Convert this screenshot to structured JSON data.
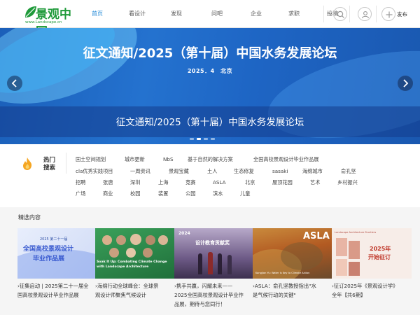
{
  "logo": {
    "text": "景观中国",
    "url": "www.Landscape.cn"
  },
  "nav": [
    {
      "label": "首页",
      "active": true
    },
    {
      "label": "看设计",
      "active": false
    },
    {
      "label": "发现",
      "active": false
    },
    {
      "label": "问吧",
      "active": false
    },
    {
      "label": "企业",
      "active": false
    },
    {
      "label": "求职",
      "active": false
    },
    {
      "label": "投稿",
      "active": false
    }
  ],
  "header_actions": {
    "publish_label": "发布",
    "icons": [
      "search-icon",
      "user-icon",
      "plus-icon"
    ]
  },
  "banner": {
    "title": "征文通知/2025（第十届）中国水务发展论坛",
    "subtitle": "2025．4　北京",
    "caption": "征文通知/2025（第十届）中国水务发展论坛",
    "slides": 4,
    "active_slide": 1
  },
  "hot_search": {
    "label_line1": "热门",
    "label_line2": "搜索",
    "rows": [
      [
        "国土空间规划",
        "城市更新",
        "NbS",
        "基于自然的解决方案",
        "全国高校景观设计毕业作品展"
      ],
      [
        "cla优秀实践项目",
        "一周资讯",
        "景观宝藏",
        "土人",
        "生态修复",
        "sasaki",
        "海绵城市",
        "俞孔坚"
      ],
      [
        "招聘",
        "张唐",
        "深圳",
        "上海",
        "竞赛",
        "ASLA",
        "北京",
        "屋顶花园",
        "艺术",
        "乡村振兴"
      ],
      [
        "广场",
        "商业",
        "校园",
        "装置",
        "公园",
        "滨水",
        "儿童"
      ]
    ]
  },
  "featured": {
    "title": "精选内容",
    "cards": [
      {
        "caption_line1": "征集启动 | 2025第二十一届全",
        "caption_line2": "国高校景观设计毕业作品展",
        "caption_line3": "",
        "image": "graduation-exhibition-poster",
        "poster_line1": "2025 第二十一届",
        "poster_line2": "全国高校景观设计",
        "poster_line3": "毕业作品展"
      },
      {
        "caption_line1": "海绵行动全球峰会：全球景",
        "caption_line2": "观设计师聚焦气候设计",
        "caption_line3": "",
        "image": "climate-summit-speakers",
        "poster_line1": "Soak It Up: Combating Climate Change",
        "poster_line2": "with Landscape Architecture",
        "poster_line3": ""
      },
      {
        "caption_line1": "携手共赢，闪耀未来——",
        "caption_line2": "2025全国高校景观设计毕业作",
        "caption_line3": "品展，期待与您同行！",
        "image": "exhibition-stage-photo",
        "poster_line1": "2024",
        "poster_line2": "设计教育贡献奖",
        "poster_line3": ""
      },
      {
        "caption_line1": "ASLA：俞孔坚教授指出\"水",
        "caption_line2": "是气候行动的关键\"",
        "caption_line3": "",
        "image": "asla-aerial-photo",
        "poster_line1": "ASLA",
        "poster_line2": "Kongjian Yu: Water Is Key to Climate Action",
        "poster_line3": ""
      },
      {
        "caption_line1": "征订2025年《景观设计学》",
        "caption_line2": "全年【共6期】",
        "caption_line3": "",
        "image": "journal-subscription-poster",
        "poster_line1": "2025年",
        "poster_line2": "开始征订",
        "poster_line3": "Landscape Architecture Frontiers"
      }
    ]
  },
  "colors": {
    "accent": "#2b8ed8",
    "brand_green": "#1f9a3a",
    "banner_blue": "#1f67c6"
  }
}
